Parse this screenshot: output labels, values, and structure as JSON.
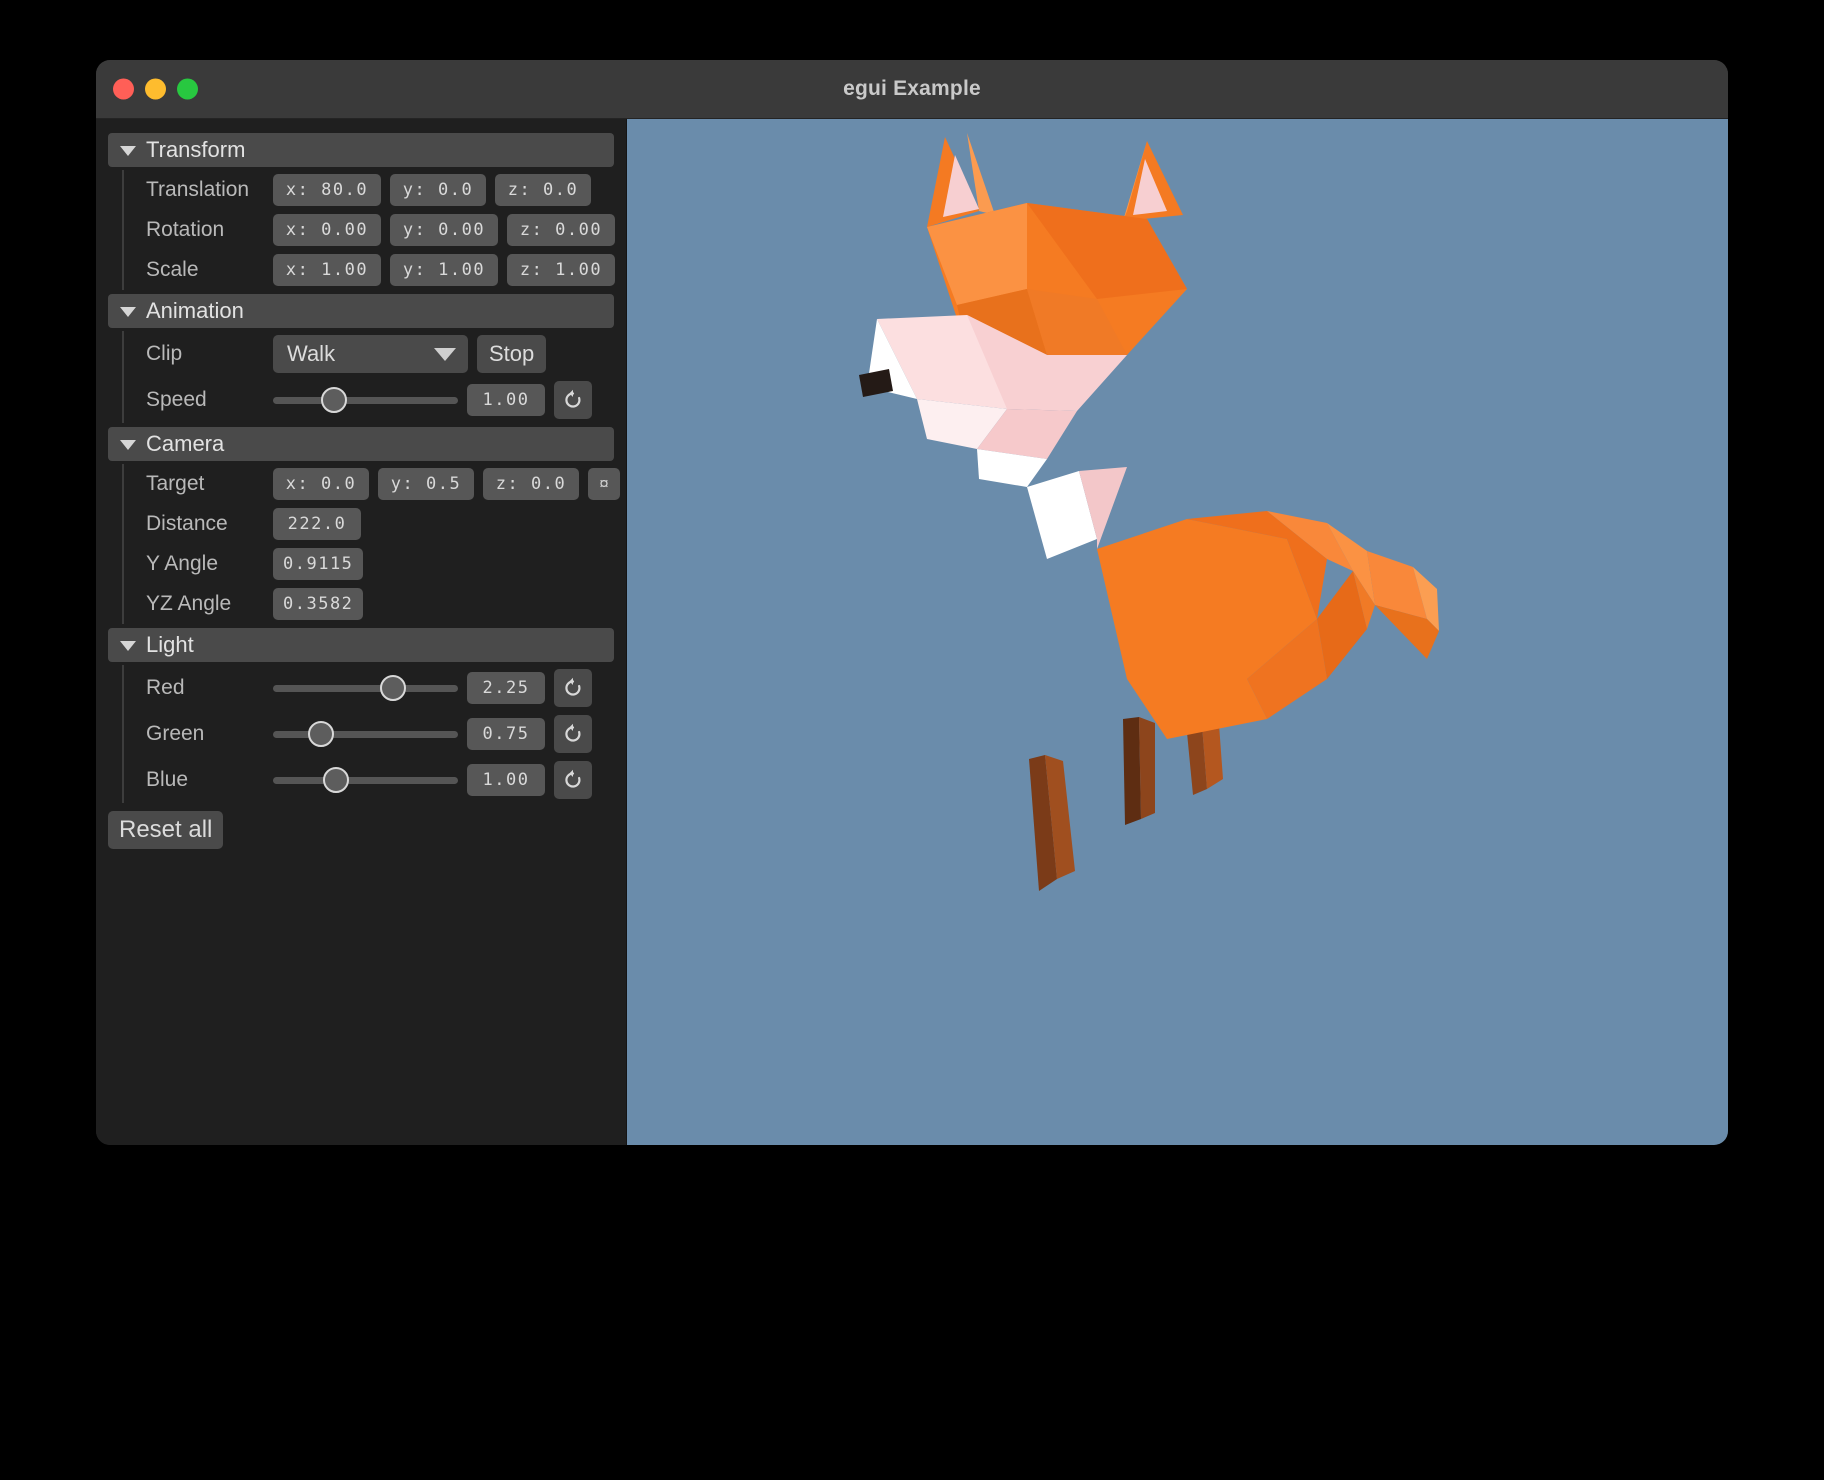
{
  "window": {
    "title": "egui Example",
    "traffic_lights": [
      "close",
      "minimize",
      "zoom"
    ],
    "colors": {
      "titlebar": "#3a3a3a",
      "panel": "#1f1f1f",
      "viewport": "#6a8cab",
      "accent_widget": "#575757",
      "close": "#ff5f57",
      "minimize": "#febc2e",
      "zoom": "#28c840"
    }
  },
  "panel": {
    "sections": [
      {
        "name": "transform",
        "title": "Transform",
        "expanded": true,
        "rows": [
          {
            "label": "Translation",
            "fields": [
              "x: 80.0",
              "y: 0.0",
              "z: 0.0"
            ]
          },
          {
            "label": "Rotation",
            "fields": [
              "x: 0.00",
              "y: 0.00",
              "z: 0.00"
            ]
          },
          {
            "label": "Scale",
            "fields": [
              "x: 1.00",
              "y: 1.00",
              "z: 1.00"
            ]
          }
        ]
      },
      {
        "name": "animation",
        "title": "Animation",
        "expanded": true,
        "clip": {
          "label": "Clip",
          "selected": "Walk",
          "stop_label": "Stop"
        },
        "speed": {
          "label": "Speed",
          "value": "1.00",
          "slider_percent": 33,
          "reset_icon": "reset-icon"
        }
      },
      {
        "name": "camera",
        "title": "Camera",
        "expanded": true,
        "rows": [
          {
            "label": "Target",
            "fields": [
              "x: 0.0",
              "y: 0.5",
              "z: 0.0"
            ],
            "extra_button": "¤"
          },
          {
            "label": "Distance",
            "fields": [
              "222.0"
            ]
          },
          {
            "label": "Y Angle",
            "fields": [
              "0.9115"
            ]
          },
          {
            "label": "YZ Angle",
            "fields": [
              "0.3582"
            ]
          }
        ]
      },
      {
        "name": "light",
        "title": "Light",
        "expanded": true,
        "sliders": [
          {
            "label": "Red",
            "value": "2.25",
            "slider_percent": 65,
            "reset_icon": "reset-icon"
          },
          {
            "label": "Green",
            "value": "0.75",
            "slider_percent": 26,
            "reset_icon": "reset-icon"
          },
          {
            "label": "Blue",
            "value": "1.00",
            "slider_percent": 34,
            "reset_icon": "reset-icon"
          }
        ]
      }
    ],
    "reset_all_label": "Reset all"
  },
  "viewport": {
    "scene": "low-poly fox model on blue background",
    "background_color": "#6a8cab"
  }
}
